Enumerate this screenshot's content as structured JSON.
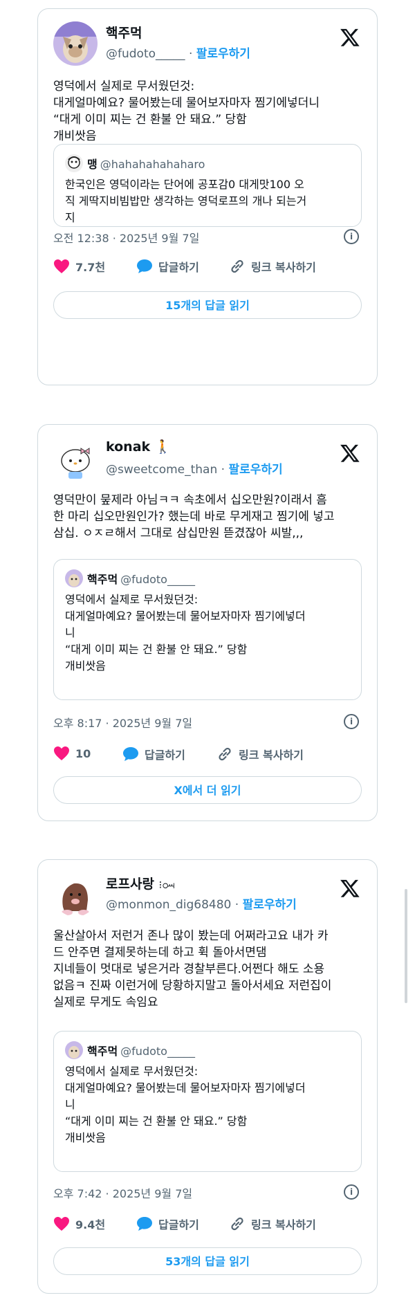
{
  "tweets": [
    {
      "name": "핵주먹",
      "handle": "@fudoto_____",
      "separator": "·",
      "follow_label": "팔로우하기",
      "text": "영덕에서 실제로 무서웠던것:\n대게얼마예요? 물어봤는데 물어보자마자 찜기에넣더니\n“대게 이미 찌는 건 환불 안 돼요.” 당함\n개비쌋음",
      "quote": {
        "name": "맹",
        "handle": "@hahahahahaharo",
        "text": "한국인은 영덕이라는 단어에 공포감0 대게맛100 오\n직 게딱지비빔밥만 생각하는 영덕로프의 개나 되는거\n지"
      },
      "timestamp": "오전 12:38 · 2025년 9월 7일",
      "likes": "7.7천",
      "reply_label": "답글하기",
      "copy_label": "링크 복사하기",
      "read_label": "15개의 답글 읽기"
    },
    {
      "name": "konak",
      "name_emoji": "🚶",
      "handle": "@sweetcome_than",
      "separator": "·",
      "follow_label": "팔로우하기",
      "text": "영덕만이 뭎제라 아님ㅋㅋ 속초에서 십오만원?이래서 흠\n한 마리 십오만원인가? 했는데 바로 무게재고 찜기에 넣고\n삼십. ㅇㅈㄹ해서 그대로 삼십만원 뜯겼잖아 씨발,,,",
      "quote": {
        "name": "핵주먹",
        "handle": "@fudoto_____",
        "text": "영덕에서 실제로 무서웠던것:\n대게얼마예요? 물어봤는데 물어보자마자 찜기에넣더\n니\n“대게 이미 찌는 건 환불 안 돼요.” 당함\n개비쌋음"
      },
      "timestamp": "오후 8:17 · 2025년 9월 7일",
      "likes": "10",
      "reply_label": "답글하기",
      "copy_label": "링크 복사하기",
      "read_label": "X에서 더 읽기"
    },
    {
      "name": "로프사랑",
      "name_emoji": "⁝ꗢ",
      "handle": "@monmon_dig68480",
      "separator": "·",
      "follow_label": "팔로우하기",
      "text": "울산살아서 저런거 존나 많이 봤는데 어쩌라고요 내가 카\n드 안주면 결제못하는데 하고 휙 돌아서면댐\n지네들이 멋대로 넣은거라 경찰부른다.어쩐다 해도 소용\n없음ㅋ 진짜 이런거에 당황하지말고 돌아서세요 저런집이\n실제로 무게도 속임요",
      "quote": {
        "name": "핵주먹",
        "handle": "@fudoto_____",
        "text": "영덕에서 실제로 무서웠던것:\n대게얼마예요? 물어봤는데 물어보자마자 찜기에넣더\n니\n“대게 이미 찌는 건 환불 안 돼요.” 당함\n개비쌋음"
      },
      "timestamp": "오후 7:42 · 2025년 9월 7일",
      "likes": "9.4천",
      "reply_label": "답글하기",
      "copy_label": "링크 복사하기",
      "read_label": "53개의 답글 읽기"
    }
  ],
  "colors": {
    "accent": "#1d9bf0",
    "like": "#f91880",
    "muted": "#536471",
    "border": "#cfd9de"
  },
  "icons": [
    "x-logo-icon",
    "heart-icon",
    "reply-bubble-icon",
    "link-icon",
    "info-icon"
  ]
}
